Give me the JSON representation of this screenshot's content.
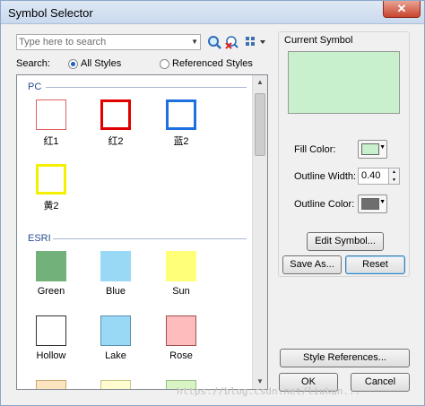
{
  "window": {
    "title": "Symbol Selector",
    "close_glyph": "✕"
  },
  "search": {
    "placeholder": "Type here to search",
    "label": "Search:",
    "options": [
      "All Styles",
      "Referenced Styles"
    ],
    "selected": "All Styles"
  },
  "groups": [
    {
      "name": "PC",
      "symbols": [
        {
          "label": "红1",
          "fill": "#ffffff",
          "outline": "#e06060"
        },
        {
          "label": "红2",
          "fill": "#ffffff",
          "outline": "#e00000"
        },
        {
          "label": "蓝2",
          "fill": "#ffffff",
          "outline": "#1e6fe0"
        },
        {
          "label": "黄2",
          "fill": "#ffffff",
          "outline": "#f5f000"
        }
      ]
    },
    {
      "name": "ESRI",
      "symbols": [
        {
          "label": "Green",
          "fill": "#72b27a",
          "outline": "#72b27a"
        },
        {
          "label": "Blue",
          "fill": "#9ad9f5",
          "outline": "#9ad9f5"
        },
        {
          "label": "Sun",
          "fill": "#ffff78",
          "outline": "#ffff78"
        },
        {
          "label": "Hollow",
          "fill": "#ffffff",
          "outline": "#333333"
        },
        {
          "label": "Lake",
          "fill": "#9ad9f5",
          "outline": "#5a8fb0"
        },
        {
          "label": "Rose",
          "fill": "#ffbcbc",
          "outline": "#a05050"
        }
      ]
    }
  ],
  "current_symbol": {
    "label": "Current Symbol",
    "preview_fill": "#c8f0cc",
    "fill_color_label": "Fill Color:",
    "fill_color": "#c8f0cc",
    "outline_width_label": "Outline Width:",
    "outline_width": "0.40",
    "outline_color_label": "Outline Color:",
    "outline_color": "#6e6e6e"
  },
  "buttons": {
    "edit_symbol": "Edit Symbol...",
    "save_as": "Save As...",
    "reset": "Reset",
    "style_references": "Style References...",
    "ok": "OK",
    "cancel": "Cancel"
  },
  "watermark": "https://blog.csdn.net/liukun..."
}
